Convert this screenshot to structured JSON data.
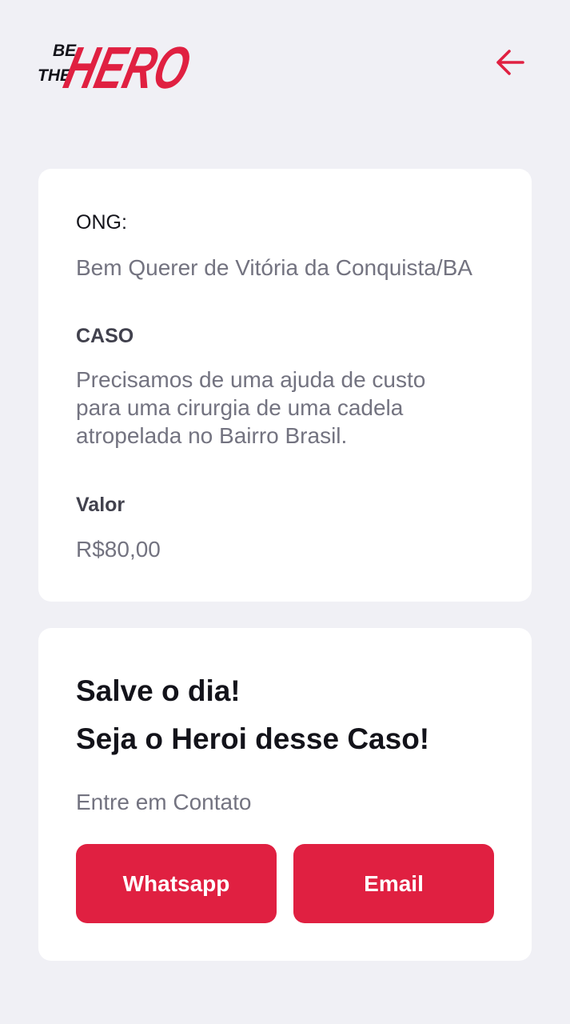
{
  "brand": {
    "logo_text_small_1": "BE",
    "logo_text_small_2": "THE",
    "logo_text_large": "HERO",
    "accent_color": "#e02041"
  },
  "header": {
    "back_icon": "arrow-left-icon"
  },
  "incident": {
    "ong_label": "ONG:",
    "ong_value": "Bem Querer de Vitória da Conquista/BA",
    "case_label": "CASO",
    "case_lines": [
      "Precisamos de uma ajuda de custo",
      "para uma cirurgia de uma cadela",
      "atropelada no Bairro Brasil."
    ],
    "value_label": "Valor",
    "value_amount": "R$80,00"
  },
  "contact": {
    "title_line_1": "Salve o dia!",
    "title_line_2": "Seja o Heroi desse Caso!",
    "description": "Entre em Contato",
    "whatsapp_label": "Whatsapp",
    "email_label": "Email"
  }
}
